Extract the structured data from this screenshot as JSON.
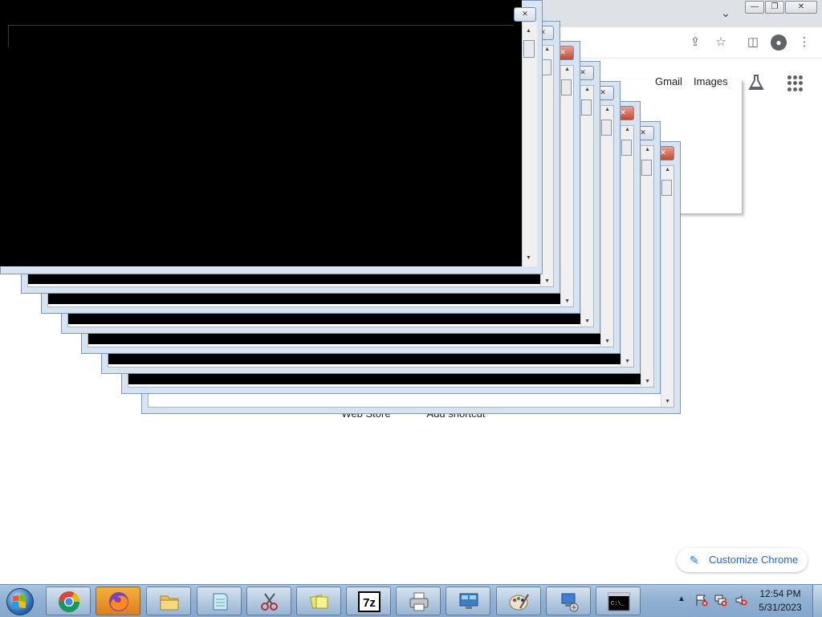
{
  "chrome": {
    "header_links": {
      "gmail": "Gmail",
      "images": "Images"
    },
    "shortcuts": [
      {
        "label": "Web Store"
      },
      {
        "label": "Add shortcut"
      }
    ],
    "customize_label": "Customize Chrome",
    "icons": [
      "tab-search-icon",
      "share-icon",
      "bookmark-star-icon",
      "side-panel-icon",
      "profile-icon",
      "menu-icon",
      "labs-icon",
      "apps-grid-icon",
      "pencil-icon"
    ]
  },
  "console_window": {
    "icons": [
      "close-icon",
      "scroll-up-icon",
      "scroll-down-icon"
    ]
  },
  "taskbar": {
    "apps": [
      {
        "name": "Google Chrome",
        "icon": "chrome-icon"
      },
      {
        "name": "Firefox",
        "icon": "firefox-icon"
      },
      {
        "name": "Windows Explorer",
        "icon": "folder-icon"
      },
      {
        "name": "Notepad",
        "icon": "notepad-icon"
      },
      {
        "name": "Snipping Tool",
        "icon": "scissors-icon"
      },
      {
        "name": "Sticky Notes",
        "icon": "sticky-notes-icon"
      },
      {
        "name": "7-Zip",
        "icon": "7zip-icon",
        "text": "7z"
      },
      {
        "name": "Printer",
        "icon": "printer-icon"
      },
      {
        "name": "Remote Desktop",
        "icon": "remote-desktop-icon"
      },
      {
        "name": "Paint",
        "icon": "paint-icon"
      },
      {
        "name": "Network",
        "icon": "network-icon"
      },
      {
        "name": "Command Prompt",
        "icon": "cmd-icon",
        "text": "C:\\_"
      }
    ],
    "tray": {
      "time": "12:54 PM",
      "date": "5/31/2023",
      "icons": [
        "show-hidden-icons-arrow",
        "action-center-flag-icon",
        "network-icon",
        "volume-muted-icon"
      ]
    },
    "colors": {
      "bar_top": "#a9c4de",
      "bar_bottom": "#86a8cb"
    }
  }
}
